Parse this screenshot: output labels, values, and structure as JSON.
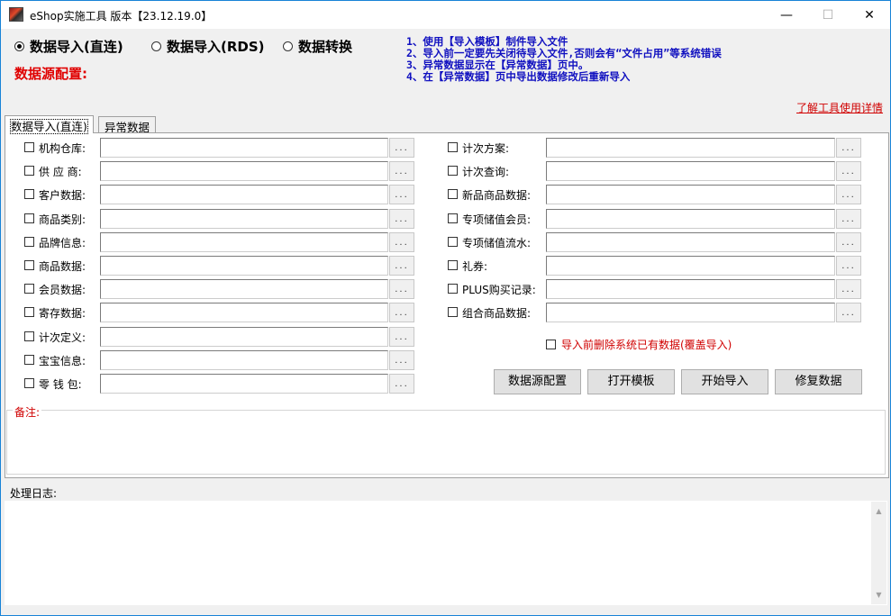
{
  "window": {
    "title": "eShop实施工具   版本【23.12.19.0】",
    "minimize": "—",
    "maximize": "☐",
    "close": "✕"
  },
  "modes": [
    {
      "label": "数据导入(直连)",
      "selected": true
    },
    {
      "label": "数据导入(RDS)",
      "selected": false
    },
    {
      "label": "数据转换",
      "selected": false
    }
  ],
  "data_source_label": "数据源配置:",
  "notes": [
    "1、使用【导入模板】制件导入文件",
    "2、导入前一定要先关闭待导入文件,否则会有“文件占用”等系统错误",
    "3、异常数据显示在【异常数据】页中。",
    "4、在【异常数据】页中导出数据修改后重新导入"
  ],
  "help_link": "了解工具使用详情",
  "tabs": [
    {
      "label": "数据导入(直连)",
      "active": true
    },
    {
      "label": "异常数据",
      "active": false
    }
  ],
  "left_items": [
    {
      "label": "机构仓库:",
      "checked": false,
      "value": ""
    },
    {
      "label": "供 应 商:",
      "checked": false,
      "value": ""
    },
    {
      "label": "客户数据:",
      "checked": false,
      "value": ""
    },
    {
      "label": "商品类别:",
      "checked": false,
      "value": ""
    },
    {
      "label": "品牌信息:",
      "checked": false,
      "value": ""
    },
    {
      "label": "商品数据:",
      "checked": false,
      "value": ""
    },
    {
      "label": "会员数据:",
      "checked": false,
      "value": ""
    },
    {
      "label": "寄存数据:",
      "checked": false,
      "value": ""
    },
    {
      "label": "计次定义:",
      "checked": false,
      "value": ""
    },
    {
      "label": "宝宝信息:",
      "checked": false,
      "value": ""
    },
    {
      "label": "零 钱 包:",
      "checked": false,
      "value": ""
    }
  ],
  "right_items": [
    {
      "label": "计次方案:",
      "checked": false,
      "value": ""
    },
    {
      "label": "计次查询:",
      "checked": false,
      "value": ""
    },
    {
      "label": "新品商品数据:",
      "checked": false,
      "value": ""
    },
    {
      "label": "专项储值会员:",
      "checked": false,
      "value": ""
    },
    {
      "label": "专项储值流水:",
      "checked": false,
      "value": ""
    },
    {
      "label": "礼券:",
      "checked": false,
      "value": ""
    },
    {
      "label": "PLUS购买记录:",
      "checked": false,
      "value": ""
    },
    {
      "label": "组合商品数据:",
      "checked": false,
      "value": ""
    }
  ],
  "browse_label": "...",
  "overwrite_option": {
    "label": "导入前删除系统已有数据(覆盖导入)",
    "checked": false
  },
  "buttons": {
    "data_source": "数据源配置",
    "open_template": "打开模板",
    "start_import": "开始导入",
    "repair_data": "修复数据"
  },
  "remark_label": "备注:",
  "remark_value": "",
  "log_label": "处理日志:",
  "log_value": "",
  "icons": {
    "app": "eshop-app-icon",
    "scroll_up": "▲",
    "scroll_down": "▼"
  },
  "colors": {
    "title_border": "#1883d7",
    "notes": "#1010c0",
    "alert": "#e00000"
  }
}
